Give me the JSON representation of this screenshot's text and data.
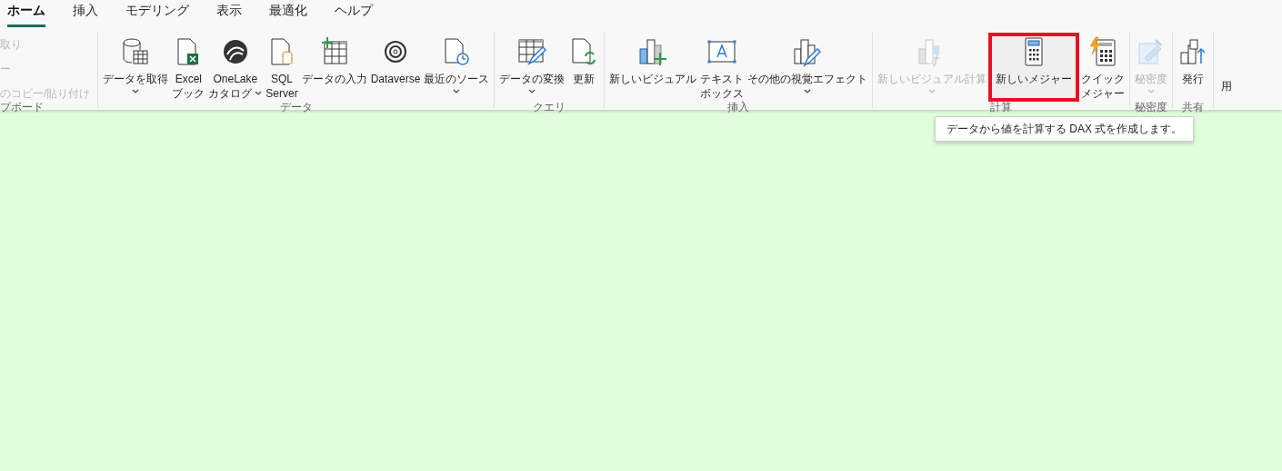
{
  "tabs": [
    {
      "label": "ホーム",
      "selected": true
    },
    {
      "label": "挿入",
      "selected": false
    },
    {
      "label": "モデリング",
      "selected": false
    },
    {
      "label": "表示",
      "selected": false
    },
    {
      "label": "最適化",
      "selected": false
    },
    {
      "label": "ヘルプ",
      "selected": false
    }
  ],
  "clipboard": {
    "items": [
      "取り",
      "ー",
      "のコピー/貼り付け"
    ],
    "label": "プボード"
  },
  "groups": [
    {
      "label": "データ",
      "buttons": [
        {
          "kind": "database",
          "lines": [
            "データを取得"
          ],
          "dropdown": true,
          "disabled": false,
          "highlighted": false
        },
        {
          "kind": "excel",
          "lines": [
            "Excel",
            "ブック"
          ],
          "dropdown": false,
          "disabled": false,
          "highlighted": false
        },
        {
          "kind": "onelake",
          "lines": [
            "OneLake",
            "カタログ"
          ],
          "dropdown": true,
          "disabled": false,
          "highlighted": false
        },
        {
          "kind": "sql",
          "lines": [
            "SQL",
            "Server"
          ],
          "dropdown": false,
          "disabled": false,
          "highlighted": false
        },
        {
          "kind": "enter",
          "lines": [
            "データの入力"
          ],
          "dropdown": false,
          "disabled": false,
          "highlighted": false
        },
        {
          "kind": "dataverse",
          "lines": [
            "Dataverse"
          ],
          "dropdown": false,
          "disabled": false,
          "highlighted": false
        },
        {
          "kind": "recent",
          "lines": [
            "最近のソース"
          ],
          "dropdown": true,
          "disabled": false,
          "highlighted": false
        }
      ]
    },
    {
      "label": "クエリ",
      "buttons": [
        {
          "kind": "transform",
          "lines": [
            "データの変換"
          ],
          "dropdown": true,
          "disabled": false,
          "highlighted": false
        },
        {
          "kind": "refresh",
          "lines": [
            "更新"
          ],
          "dropdown": false,
          "disabled": false,
          "highlighted": false
        }
      ]
    },
    {
      "label": "挿入",
      "buttons": [
        {
          "kind": "newvisual",
          "lines": [
            "新しいビジュアル"
          ],
          "dropdown": false,
          "disabled": false,
          "highlighted": false
        },
        {
          "kind": "textbox",
          "lines": [
            "テキスト",
            "ボックス"
          ],
          "dropdown": false,
          "disabled": false,
          "highlighted": false
        },
        {
          "kind": "morevisual",
          "lines": [
            "その他の視覚エフェクト"
          ],
          "dropdown": true,
          "disabled": false,
          "highlighted": false
        }
      ]
    },
    {
      "label": "計算",
      "buttons": [
        {
          "kind": "visualcalc",
          "lines": [
            "新しいビジュアル計算"
          ],
          "dropdown": true,
          "disabled": true,
          "highlighted": false
        },
        {
          "kind": "measure",
          "lines": [
            "新しいメジャー"
          ],
          "dropdown": false,
          "disabled": false,
          "highlighted": true
        },
        {
          "kind": "quick",
          "lines": [
            "クイック",
            "メジャー"
          ],
          "dropdown": false,
          "disabled": false,
          "highlighted": false
        }
      ]
    },
    {
      "label": "秘密度",
      "buttons": [
        {
          "kind": "sensitivity",
          "lines": [
            "秘密度"
          ],
          "dropdown": true,
          "disabled": true,
          "highlighted": false
        }
      ]
    },
    {
      "label": "共有",
      "buttons": [
        {
          "kind": "publish",
          "lines": [
            "発行"
          ],
          "dropdown": false,
          "disabled": false,
          "highlighted": false
        }
      ]
    }
  ],
  "overflow": "用",
  "tooltip": "データから値を計算する DAX 式を作成します。"
}
